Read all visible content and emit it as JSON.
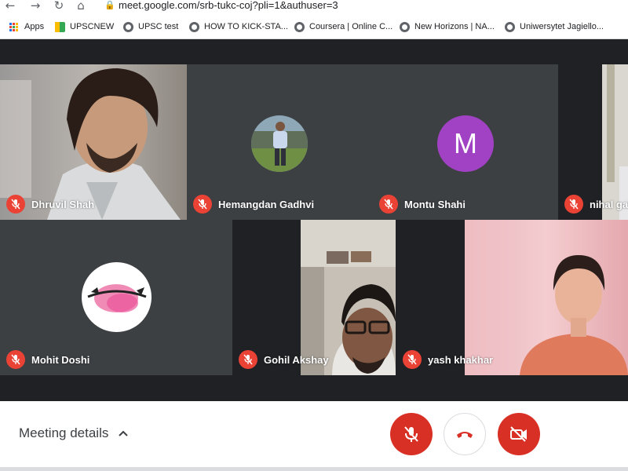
{
  "browser": {
    "nav_icons": [
      "back-icon",
      "forward-icon",
      "reload-icon",
      "home-icon"
    ],
    "url": "meet.google.com/srb-tukc-coj?pli=1&authuser=3",
    "bookmarks": [
      {
        "label": "Apps",
        "icon": "apps-grid-icon"
      },
      {
        "label": "UPSCNEW",
        "icon": "classroom-icon"
      },
      {
        "label": "UPSC  test",
        "icon": "globe-icon"
      },
      {
        "label": "HOW TO KICK-STA...",
        "icon": "globe-icon"
      },
      {
        "label": "Coursera | Online C...",
        "icon": "globe-icon"
      },
      {
        "label": "New Horizons | NA...",
        "icon": "globe-icon"
      },
      {
        "label": "Uniwersytet Jagiello...",
        "icon": "globe-icon"
      }
    ]
  },
  "participants": [
    {
      "name": "Dhruvil Shah",
      "muted": true,
      "display": "video"
    },
    {
      "name": "Hemangdan Gadhvi",
      "muted": true,
      "display": "photo-avatar"
    },
    {
      "name": "Montu Shahi",
      "muted": true,
      "display": "letter-avatar",
      "initial": "M",
      "color": "#a142c4"
    },
    {
      "name": "nihal gal",
      "muted": true,
      "display": "video"
    },
    {
      "name": "Mohit Doshi",
      "muted": true,
      "display": "photo-avatar"
    },
    {
      "name": "Gohil Akshay",
      "muted": true,
      "display": "video"
    },
    {
      "name": "yash khakhar",
      "muted": true,
      "display": "video"
    }
  ],
  "controls": {
    "meeting_details_label": "Meeting details",
    "mic_state": "off",
    "camera_state": "off",
    "accent_red": "#d93025"
  }
}
